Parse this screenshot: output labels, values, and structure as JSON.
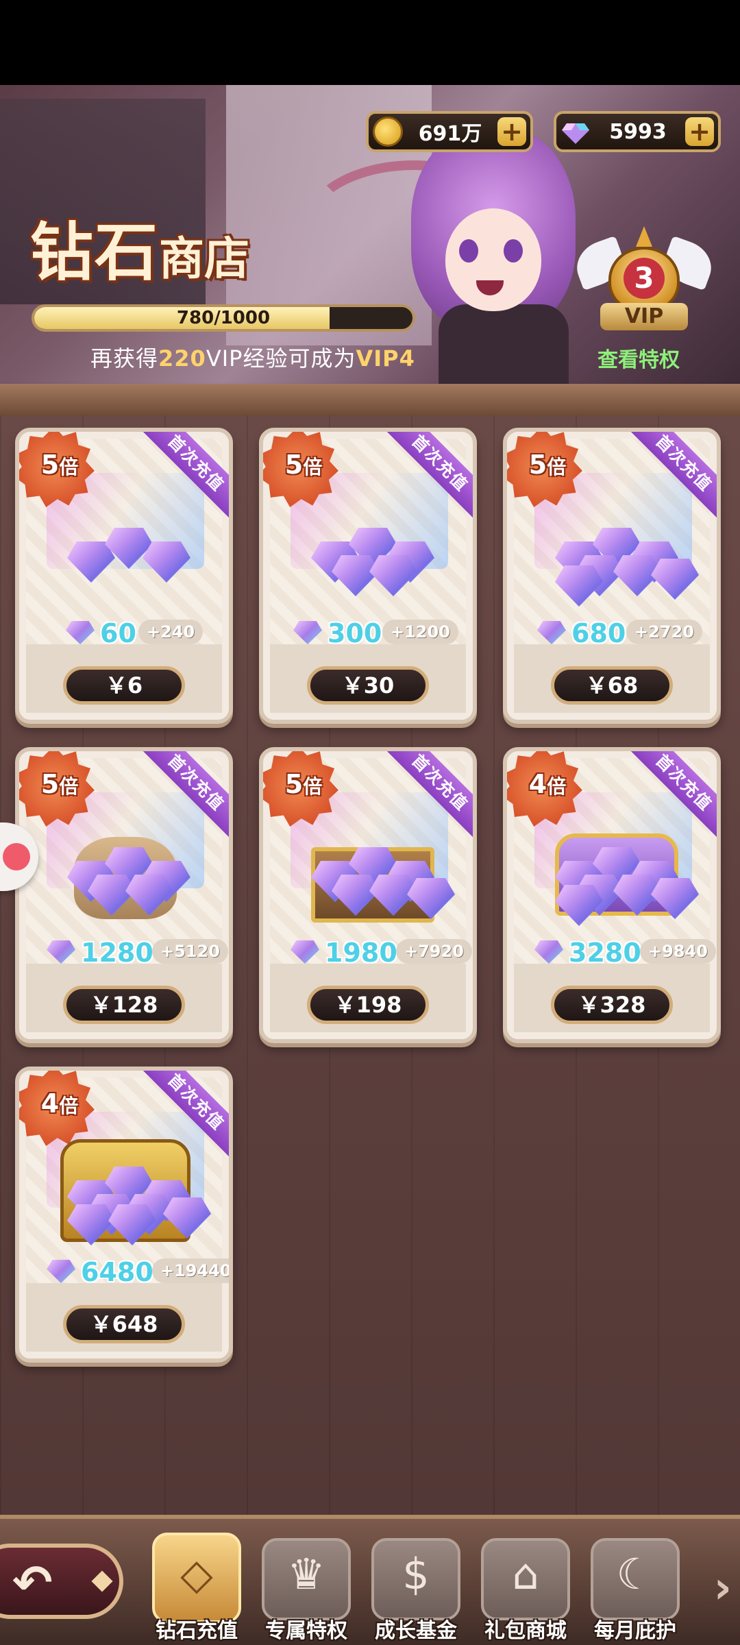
{
  "header": {
    "title_big": "钻石",
    "title_small": "商店",
    "coins": "691万",
    "diamonds": "5993",
    "plus": "+",
    "exp_text": "780/1000",
    "exp_progress": 0.78,
    "vip_msg_prefix": "再获得",
    "vip_msg_amount": "220",
    "vip_msg_mid": "VIP经验可成为",
    "vip_msg_target": "VIP4",
    "vip_level": "3",
    "vip_label": "VIP",
    "vip_view": "查看特权"
  },
  "packs": [
    {
      "mult": "5",
      "bei": "倍",
      "ribbon": "首次充值",
      "amount": "60",
      "bonus": "+240",
      "price": "￥6",
      "art": "small"
    },
    {
      "mult": "5",
      "bei": "倍",
      "ribbon": "首次充值",
      "amount": "300",
      "bonus": "+1200",
      "price": "￥30",
      "art": "medium"
    },
    {
      "mult": "5",
      "bei": "倍",
      "ribbon": "首次充值",
      "amount": "680",
      "bonus": "+2720",
      "price": "￥68",
      "art": "large"
    },
    {
      "mult": "5",
      "bei": "倍",
      "ribbon": "首次充值",
      "amount": "1280",
      "bonus": "+5120",
      "price": "￥128",
      "art": "sack"
    },
    {
      "mult": "5",
      "bei": "倍",
      "ribbon": "首次充值",
      "amount": "1980",
      "bonus": "+7920",
      "price": "￥198",
      "art": "crate"
    },
    {
      "mult": "4",
      "bei": "倍",
      "ribbon": "首次充值",
      "amount": "3280",
      "bonus": "+9840",
      "price": "￥328",
      "art": "chest"
    },
    {
      "mult": "4",
      "bei": "倍",
      "ribbon": "首次充值",
      "amount": "6480",
      "bonus": "+19440",
      "price": "￥648",
      "art": "goldchest"
    }
  ],
  "nav": {
    "items": [
      {
        "label": "钻石充值",
        "icon": "diamond-icon",
        "glyph": "◇",
        "active": true
      },
      {
        "label": "专属特权",
        "icon": "crown-icon",
        "glyph": "♛",
        "active": false
      },
      {
        "label": "成长基金",
        "icon": "money-bag-icon",
        "glyph": "$",
        "active": false
      },
      {
        "label": "礼包商城",
        "icon": "store-icon",
        "glyph": "⌂",
        "active": false
      },
      {
        "label": "每月庇护",
        "icon": "moon-star-icon",
        "glyph": "☾",
        "active": false
      }
    ],
    "more": "›"
  }
}
